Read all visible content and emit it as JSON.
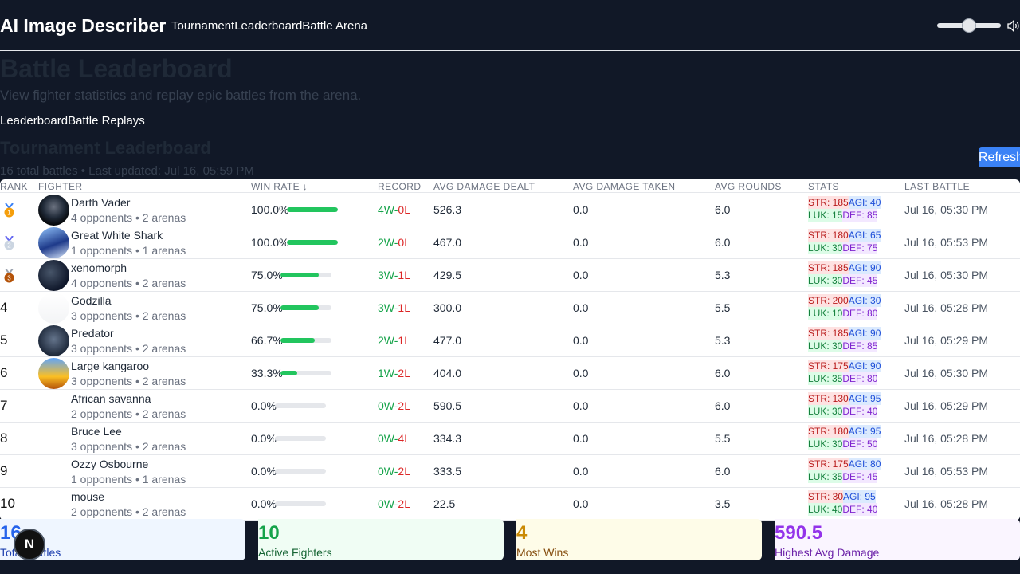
{
  "header": {
    "brand": "AI Image Describer",
    "nav": [
      "Tournament",
      "Leaderboard",
      "Battle Arena"
    ],
    "volume": 0.5
  },
  "page": {
    "title": "Battle Leaderboard",
    "subtitle": "View fighter statistics and replay epic battles from the arena.",
    "tabs": [
      "Leaderboard",
      "Battle Replays"
    ]
  },
  "leaderboard": {
    "title": "Tournament Leaderboard",
    "meta": "16 total battles • Last updated: Jul 16, 05:59 PM",
    "refresh_label": "Refresh",
    "columns": {
      "rank": "RANK",
      "fighter": "FIGHTER",
      "win_rate": "WIN RATE ↓",
      "record": "RECORD",
      "dealt": "AVG DAMAGE DEALT",
      "taken": "AVG DAMAGE TAKEN",
      "rounds": "AVG ROUNDS",
      "stats": "STATS",
      "last": "LAST BATTLE"
    },
    "rows": [
      {
        "rank": "1",
        "medal": "gold-medal-icon",
        "name": "Darth Vader",
        "sub": "4 opponents • 2 arenas",
        "avatar": "dark",
        "win_rate": "100.0%",
        "win_fraction": 1.0,
        "wins": "4W",
        "losses": "0L",
        "dealt": "526.3",
        "taken": "0.0",
        "rounds": "6.0",
        "str": "STR: 185",
        "agi": "AGI: 40",
        "luk": "LUK: 15",
        "def": "DEF: 85",
        "last": "Jul 16, 05:30 PM"
      },
      {
        "rank": "2",
        "medal": "silver-medal-icon",
        "name": "Great White Shark",
        "sub": "1 opponents • 1 arenas",
        "avatar": "shark",
        "win_rate": "100.0%",
        "win_fraction": 1.0,
        "wins": "2W",
        "losses": "0L",
        "dealt": "467.0",
        "taken": "0.0",
        "rounds": "6.0",
        "str": "STR: 180",
        "agi": "AGI: 65",
        "luk": "LUK: 30",
        "def": "DEF: 75",
        "last": "Jul 16, 05:53 PM"
      },
      {
        "rank": "3",
        "medal": "bronze-medal-icon",
        "name": "xenomorph",
        "sub": "4 opponents • 2 arenas",
        "avatar": "xeno",
        "win_rate": "75.0%",
        "win_fraction": 0.75,
        "wins": "3W",
        "losses": "1L",
        "dealt": "429.5",
        "taken": "0.0",
        "rounds": "5.3",
        "str": "STR: 185",
        "agi": "AGI: 90",
        "luk": "LUK: 30",
        "def": "DEF: 45",
        "last": "Jul 16, 05:30 PM"
      },
      {
        "rank": "4",
        "medal": "",
        "name": "Godzilla",
        "sub": "3 opponents • 2 arenas",
        "avatar": "godzilla",
        "win_rate": "75.0%",
        "win_fraction": 0.75,
        "wins": "3W",
        "losses": "1L",
        "dealt": "300.0",
        "taken": "0.0",
        "rounds": "5.5",
        "str": "STR: 200",
        "agi": "AGI: 30",
        "luk": "LUK: 10",
        "def": "DEF: 80",
        "last": "Jul 16, 05:28 PM"
      },
      {
        "rank": "5",
        "medal": "",
        "name": "Predator",
        "sub": "3 opponents • 2 arenas",
        "avatar": "predator",
        "win_rate": "66.7%",
        "win_fraction": 0.667,
        "wins": "2W",
        "losses": "1L",
        "dealt": "477.0",
        "taken": "0.0",
        "rounds": "5.3",
        "str": "STR: 185",
        "agi": "AGI: 90",
        "luk": "LUK: 30",
        "def": "DEF: 85",
        "last": "Jul 16, 05:29 PM"
      },
      {
        "rank": "6",
        "medal": "",
        "name": "Large kangaroo",
        "sub": "3 opponents • 2 arenas",
        "avatar": "kangaroo",
        "win_rate": "33.3%",
        "win_fraction": 0.333,
        "wins": "1W",
        "losses": "2L",
        "dealt": "404.0",
        "taken": "0.0",
        "rounds": "6.0",
        "str": "STR: 175",
        "agi": "AGI: 90",
        "luk": "LUK: 35",
        "def": "DEF: 80",
        "last": "Jul 16, 05:30 PM"
      },
      {
        "rank": "7",
        "medal": "",
        "name": "African savanna",
        "sub": "2 opponents • 2 arenas",
        "avatar": "",
        "win_rate": "0.0%",
        "win_fraction": 0,
        "wins": "0W",
        "losses": "2L",
        "dealt": "590.5",
        "taken": "0.0",
        "rounds": "6.0",
        "str": "STR: 130",
        "agi": "AGI: 95",
        "luk": "LUK: 30",
        "def": "DEF: 40",
        "last": "Jul 16, 05:29 PM"
      },
      {
        "rank": "8",
        "medal": "",
        "name": "Bruce Lee",
        "sub": "3 opponents • 2 arenas",
        "avatar": "",
        "win_rate": "0.0%",
        "win_fraction": 0,
        "wins": "0W",
        "losses": "4L",
        "dealt": "334.3",
        "taken": "0.0",
        "rounds": "5.5",
        "str": "STR: 180",
        "agi": "AGI: 95",
        "luk": "LUK: 30",
        "def": "DEF: 50",
        "last": "Jul 16, 05:28 PM"
      },
      {
        "rank": "9",
        "medal": "",
        "name": "Ozzy Osbourne",
        "sub": "1 opponents • 1 arenas",
        "avatar": "",
        "win_rate": "0.0%",
        "win_fraction": 0,
        "wins": "0W",
        "losses": "2L",
        "dealt": "333.5",
        "taken": "0.0",
        "rounds": "6.0",
        "str": "STR: 175",
        "agi": "AGI: 80",
        "luk": "LUK: 35",
        "def": "DEF: 45",
        "last": "Jul 16, 05:53 PM"
      },
      {
        "rank": "10",
        "medal": "",
        "name": "mouse",
        "sub": "2 opponents • 2 arenas",
        "avatar": "",
        "win_rate": "0.0%",
        "win_fraction": 0,
        "wins": "0W",
        "losses": "2L",
        "dealt": "22.5",
        "taken": "0.0",
        "rounds": "3.5",
        "str": "STR: 30",
        "agi": "AGI: 95",
        "luk": "LUK: 40",
        "def": "DEF: 40",
        "last": "Jul 16, 05:28 PM"
      }
    ]
  },
  "summary": [
    {
      "value": "16",
      "label": "Total Battles",
      "bg": "#eff6ff",
      "color": "#2563eb",
      "label_color": "#1e40af"
    },
    {
      "value": "10",
      "label": "Active Fighters",
      "bg": "#f0fdf4",
      "color": "#16a34a",
      "label_color": "#166534"
    },
    {
      "value": "4",
      "label": "Most Wins",
      "bg": "#fefce8",
      "color": "#ca8a04",
      "label_color": "#854d0e"
    },
    {
      "value": "590.5",
      "label": "Highest Avg Damage",
      "bg": "#faf5ff",
      "color": "#9333ea",
      "label_color": "#6b21a8"
    }
  ],
  "badge": "N"
}
